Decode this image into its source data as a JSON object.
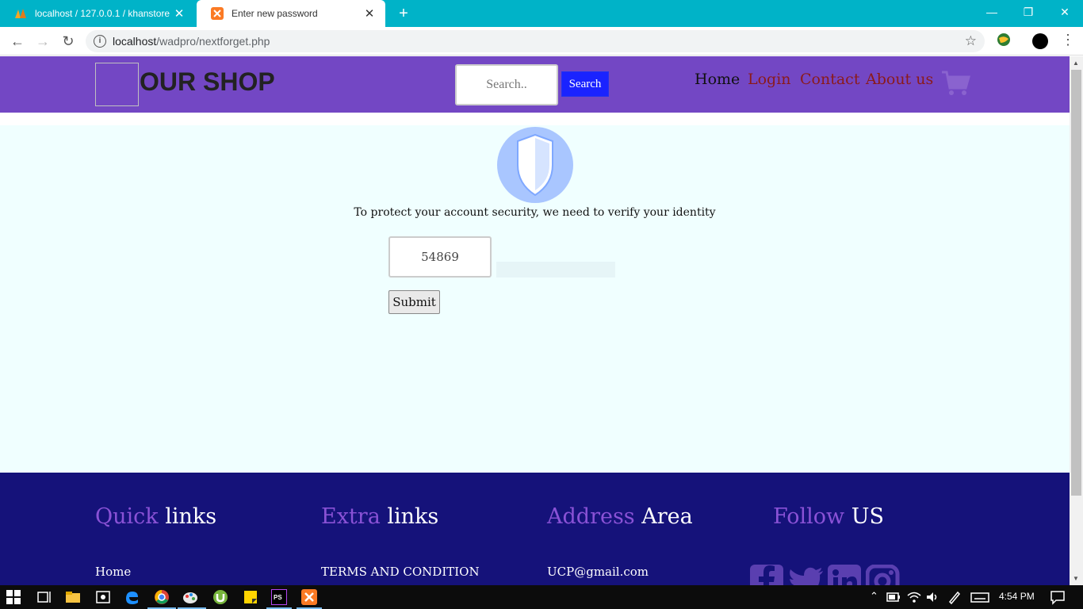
{
  "browser": {
    "tabs": [
      {
        "title": "localhost / 127.0.0.1 / khanstore",
        "icon": "phpmyadmin-icon",
        "active": false
      },
      {
        "title": "Enter new password",
        "icon": "xampp-icon",
        "active": true
      }
    ],
    "new_tab_label": "+",
    "url_host": "localhost",
    "url_path": "/wadpro/nextforget.php"
  },
  "header": {
    "title": "OUR SHOP",
    "search_placeholder": "Search..",
    "search_button": "Search",
    "nav": {
      "home": "Home",
      "login": "Login",
      "contact": "Contact",
      "about": "About us"
    }
  },
  "main": {
    "message": "To protect your account security, we need to verify your identity",
    "code_value": "54869",
    "submit_label": "Submit"
  },
  "footer": {
    "columns": [
      {
        "accent": "Quick",
        "rest": " links",
        "first_link": "Home"
      },
      {
        "accent": "Extra",
        "rest": " links",
        "first_link": "TERMS AND CONDITION"
      },
      {
        "accent": "Address",
        "rest": " Area",
        "first_link": "UCP@gmail.com"
      },
      {
        "accent": "Follow",
        "rest": " US"
      }
    ]
  },
  "taskbar": {
    "time": "4:54 PM"
  },
  "colors": {
    "header_bg": "#7347c4",
    "main_bg": "#f0ffff",
    "footer_bg": "#15127a",
    "accent": "#8a52d6",
    "search_button_bg": "#1a23ff"
  }
}
